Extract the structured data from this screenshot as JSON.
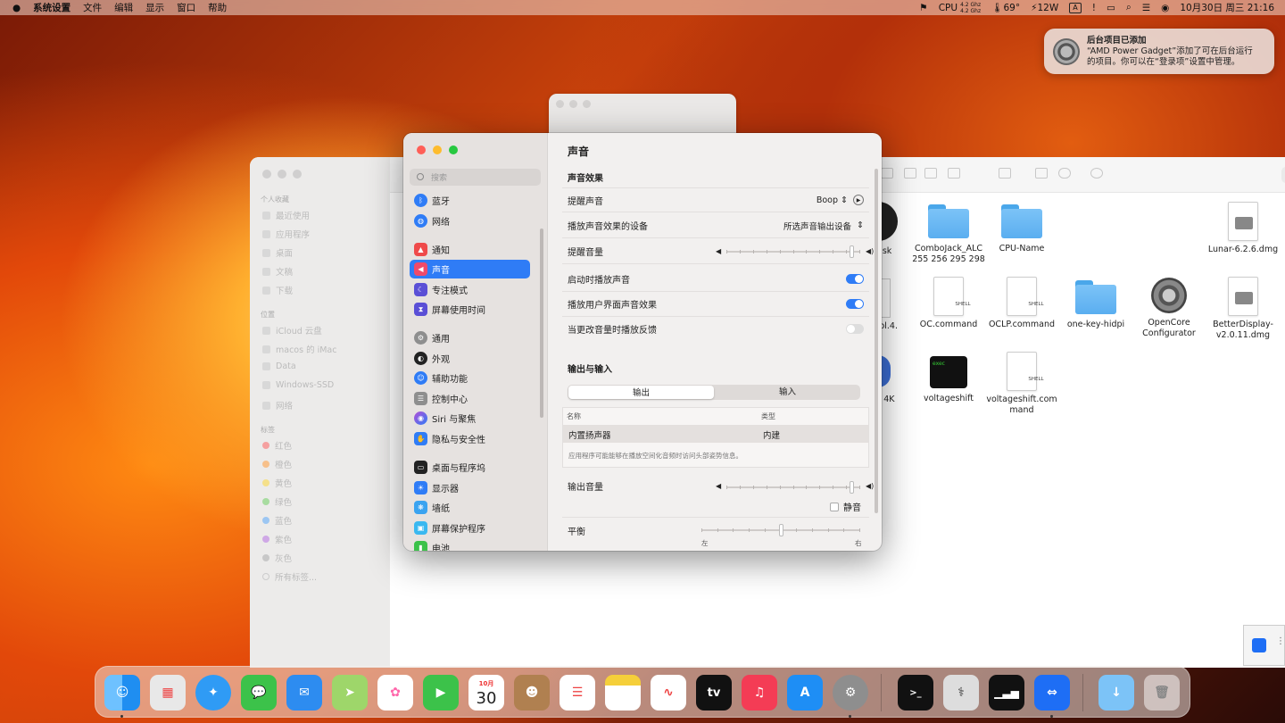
{
  "menubar": {
    "apple": "",
    "items": [
      "系统设置",
      "文件",
      "编辑",
      "显示",
      "窗口",
      "帮助"
    ],
    "cpu_label": "CPU",
    "cpu_freq_top": "4.2 Ghz",
    "cpu_freq_bottom": "4.2 Ghz",
    "temp": "69°",
    "power": "12W",
    "input_method": "A",
    "datetime": "10月30日 周三  21:16"
  },
  "notification": {
    "title": "后台项目已添加",
    "body_line1": "“AMD Power Gadget”添加了可在后台运行",
    "body_line2": "的项目。你可以在“登录项”设置中管理。"
  },
  "finder": {
    "sidebar": {
      "fav_header": "个人收藏",
      "favs": [
        "最近使用",
        "应用程序",
        "桌面",
        "文稿",
        "下载"
      ],
      "loc_header": "位置",
      "locs": [
        "iCloud 云盘",
        "macos 的 iMac",
        "Data",
        "Windows-SSD",
        "网络"
      ],
      "tag_header": "标签",
      "tags": [
        "红色",
        "橙色",
        "黄色",
        "绿色",
        "蓝色",
        "紫色",
        "灰色",
        "所有标签..."
      ],
      "tag_colors": [
        "#f5a0a0",
        "#f7c08a",
        "#f5e08a",
        "#a8dca0",
        "#9cc6f2",
        "#cfa8e6",
        "#c8c8c8",
        ""
      ]
    },
    "search_placeholder": "搜索",
    "files": [
      {
        "name": "ic Disk\nTest",
        "kind": "partial"
      },
      {
        "name": "ComboJack_ALC\n255 256 295 298",
        "kind": "folder"
      },
      {
        "name": "CPU-Name",
        "kind": "folder"
      },
      {
        "name": "Lunar-6.2.6.dmg",
        "kind": "dmg"
      },
      {
        "name": "ntrol.4.\nng",
        "kind": "partial"
      },
      {
        "name": "OC.command",
        "kind": "shell"
      },
      {
        "name": "OCLP.command",
        "kind": "shell"
      },
      {
        "name": "one-key-hidpi",
        "kind": "folder"
      },
      {
        "name": "OpenCore\nConfigurator",
        "kind": "app"
      },
      {
        "name": "BetterDisplay-\nv2.0.11.dmg",
        "kind": "dmg"
      },
      {
        "name": "c 4K",
        "kind": "partial"
      },
      {
        "name": "voltageshift",
        "kind": "exec"
      },
      {
        "name": "voltageshift.com\nmand",
        "kind": "shell"
      }
    ],
    "shell_label": "SHELL",
    "exec_label": "exec"
  },
  "settings": {
    "search_placeholder": "搜索",
    "sidebar_items": [
      {
        "label": "蓝牙",
        "icon": "bluetooth-icon",
        "color": "#2f7cf6"
      },
      {
        "label": "网络",
        "icon": "globe-icon",
        "color": "#2f7cf6"
      },
      {
        "label": "通知",
        "icon": "bell-icon",
        "color": "#ef4a4a"
      },
      {
        "label": "声音",
        "icon": "speaker-icon",
        "color": "#ef4a6a"
      },
      {
        "label": "专注模式",
        "icon": "moon-icon",
        "color": "#5a4fd6"
      },
      {
        "label": "屏幕使用时间",
        "icon": "hourglass-icon",
        "color": "#5a4fd6"
      },
      {
        "label": "通用",
        "icon": "gear-icon",
        "color": "#8e8e8e"
      },
      {
        "label": "外观",
        "icon": "appearance-icon",
        "color": "#222222"
      },
      {
        "label": "辅助功能",
        "icon": "accessibility-icon",
        "color": "#2f7cf6"
      },
      {
        "label": "控制中心",
        "icon": "control-center-icon",
        "color": "#8e8e8e"
      },
      {
        "label": "Siri 与聚焦",
        "icon": "siri-icon",
        "color": "#b44fd6"
      },
      {
        "label": "隐私与安全性",
        "icon": "hand-icon",
        "color": "#2f7cf6"
      },
      {
        "label": "桌面与程序坞",
        "icon": "dock-icon",
        "color": "#222222"
      },
      {
        "label": "显示器",
        "icon": "display-icon",
        "color": "#2f7cf6"
      },
      {
        "label": "墙纸",
        "icon": "wallpaper-icon",
        "color": "#3aa3f0"
      },
      {
        "label": "屏幕保护程序",
        "icon": "screensaver-icon",
        "color": "#3ab8f0"
      },
      {
        "label": "电池",
        "icon": "battery-icon",
        "color": "#3cc24a"
      }
    ],
    "selected": "声音",
    "page_title": "声音",
    "effects_header": "声音效果",
    "alert_sound_label": "提醒声音",
    "alert_sound_value": "Boop",
    "play_device_label": "播放声音效果的设备",
    "play_device_value": "所选声音输出设备",
    "alert_volume_label": "提醒音量",
    "alert_volume_level": 0.95,
    "startup_label": "启动时播放声音",
    "startup_on": true,
    "ui_effects_label": "播放用户界面声音效果",
    "ui_effects_on": true,
    "feedback_label": "当更改音量时播放反馈",
    "feedback_on": false,
    "io_header": "输出与输入",
    "tab_output": "输出",
    "tab_input": "输入",
    "col_name": "名称",
    "col_type": "类型",
    "device_name": "内置扬声器",
    "device_type": "内建",
    "spatial_note": "应用程序可能能够在播放空间化音频时访问头部姿势信息。",
    "output_volume_label": "输出音量",
    "output_volume_level": 0.95,
    "mute_label": "静音",
    "balance_label": "平衡",
    "balance_left": "左",
    "balance_right": "右",
    "balance_level": 0.5
  },
  "dock": {
    "calendar_month": "10月",
    "calendar_day": "30",
    "tv_label": "tv",
    "apps": [
      "finder",
      "launchpad",
      "safari",
      "messages",
      "mail",
      "maps",
      "photos",
      "facetime",
      "calendar",
      "contacts",
      "reminders",
      "notes",
      "freeform",
      "tv",
      "music",
      "app-store",
      "system-settings",
      "terminal",
      "disk-utility",
      "activity-monitor",
      "teamviewer",
      "downloads",
      "trash"
    ]
  }
}
